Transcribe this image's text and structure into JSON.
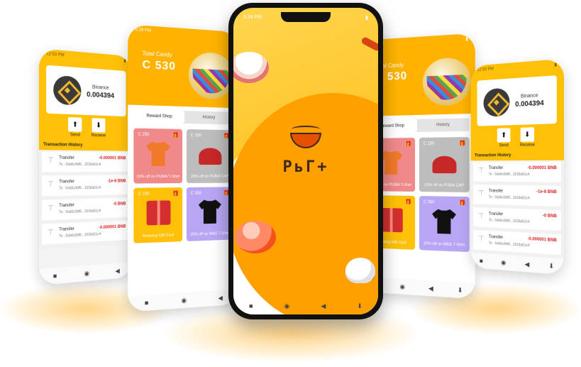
{
  "wallet_screen": {
    "status_time": "12:53 PM",
    "coin_name": "Binance",
    "balance": "0.004394",
    "send_label": "Send",
    "receive_label": "Receive",
    "tx_history_title": "Transaction History",
    "transactions": [
      {
        "label": "Transfer",
        "to": "To : 0xb6c0bf6...1018a51c4",
        "amount": "-0.000001 BNB"
      },
      {
        "label": "Transfer",
        "to": "To : 0xb6c0bf6...1018a51c4",
        "amount": "-1e-8 BNB"
      },
      {
        "label": "Transfer",
        "to": "To : 0xb6c0bf6...1018a51c4",
        "amount": "-0 BNB"
      },
      {
        "label": "Transfer",
        "to": "To : 0xb6c0bf6...1018a51c4",
        "amount": "-0.000001 BNB"
      },
      {
        "label": "Transfer",
        "to": "",
        "amount": ""
      }
    ]
  },
  "candy_screen": {
    "status_time": "5:29 PM",
    "total_label": "Total Candy",
    "total_value": "C 530",
    "tab_reward": "Reward Shop",
    "tab_history": "History",
    "items": [
      {
        "price": "C 250",
        "desc": "20% off on PUMA T-Shirt",
        "color": "#f08a8a",
        "art": "tshirt-orange"
      },
      {
        "price": "C 150",
        "desc": "20% off on PUMA CAP",
        "color": "#bdbdbd",
        "art": "cap"
      },
      {
        "price": "C 100",
        "desc": "Amazing Gift Card",
        "color": "#ffc107",
        "art": "gift-box"
      },
      {
        "price": "C 350",
        "desc": "25% off on NIKE T-Shirt",
        "color": "#b8a6f5",
        "art": "tshirt-black"
      }
    ]
  },
  "center_screen": {
    "status_time": "5:34 PM",
    "brand_text": "PьГ+",
    "accent": "#ffb300"
  }
}
